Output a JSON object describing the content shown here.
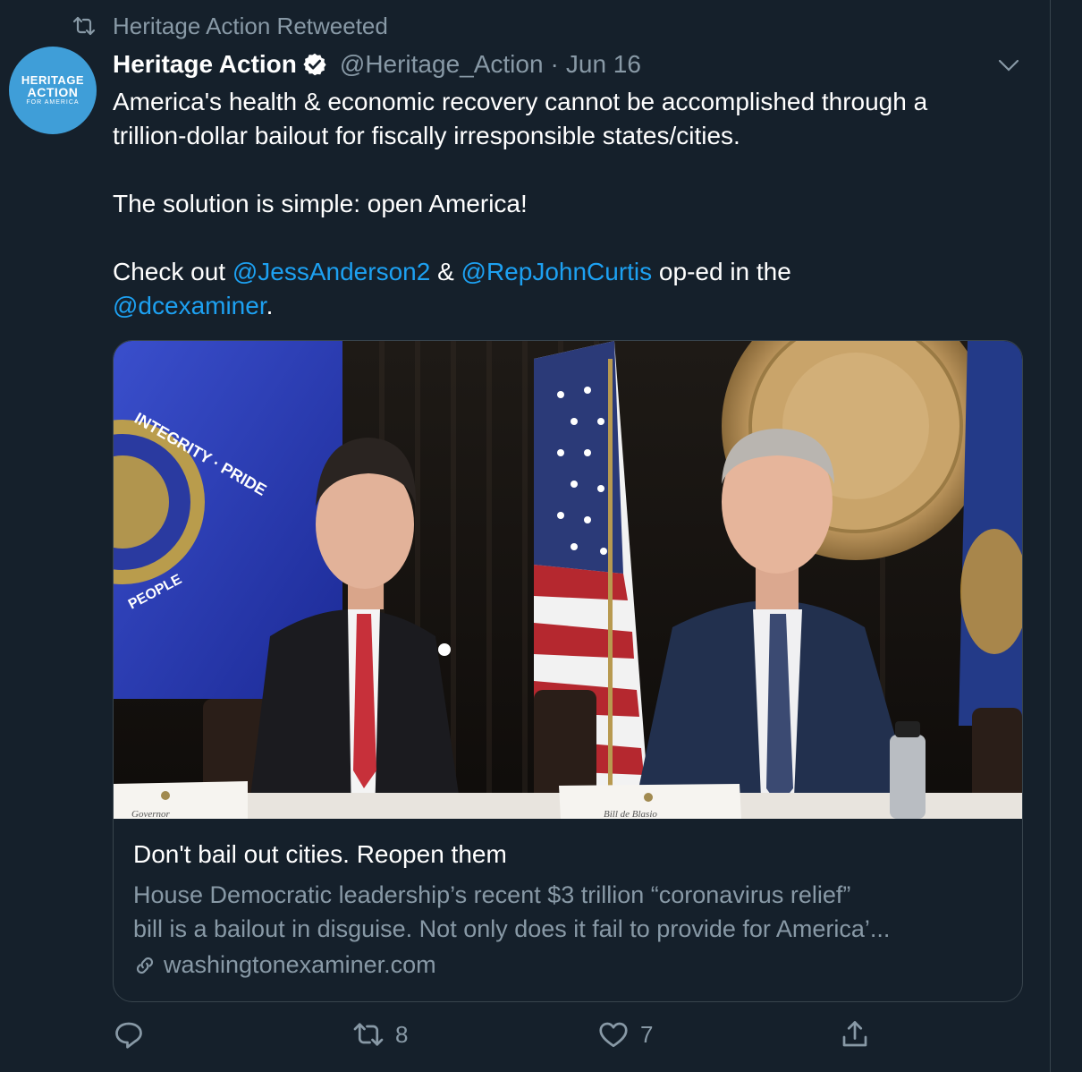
{
  "retweet_banner": {
    "label": "Heritage Action Retweeted"
  },
  "avatar": {
    "line1": "HERITAGE",
    "line2": "ACTION",
    "line3": "FOR AMERICA"
  },
  "tweet": {
    "author_name": "Heritage Action",
    "handle": "@Heritage_Action",
    "separator": "·",
    "date": "Jun 16",
    "text_line1": "America's health & economic recovery cannot be accomplished through a",
    "text_line2": "trillion-dollar bailout for fiscally irresponsible states/cities.",
    "text_line3": "The solution is simple: open America!",
    "text_prefix": "Check out ",
    "mention1": "@JessAnderson2",
    "amp": " & ",
    "mention2": "@RepJohnCurtis",
    "text_suffix": " op-ed in the",
    "mention3": "@dcexaminer",
    "period": "."
  },
  "card": {
    "image_labels": {
      "sign_left": "Governor",
      "sign_right": "Bill de Blasio",
      "seal_text": "INTEGRITY · PRIDE",
      "seal_bottom": "PEOPLE"
    },
    "title": "Don't bail out cities. Reopen them",
    "desc_line1": "House Democratic leadership’s recent $3 trillion “coronavirus relief”",
    "desc_line2": "bill is a bailout in disguise. Not only does it fail to provide for America’...",
    "domain": "washingtonexaminer.com"
  },
  "actions": {
    "reply_count": "",
    "retweet_count": "8",
    "like_count": "7"
  },
  "colors": {
    "background": "#15202b",
    "accent": "#1da1f2",
    "muted": "#8899a6",
    "border": "#38444d"
  },
  "icons": [
    "retweet-icon",
    "verified-icon",
    "chevron-down-icon",
    "link-icon",
    "reply-icon",
    "like-icon",
    "share-icon"
  ]
}
